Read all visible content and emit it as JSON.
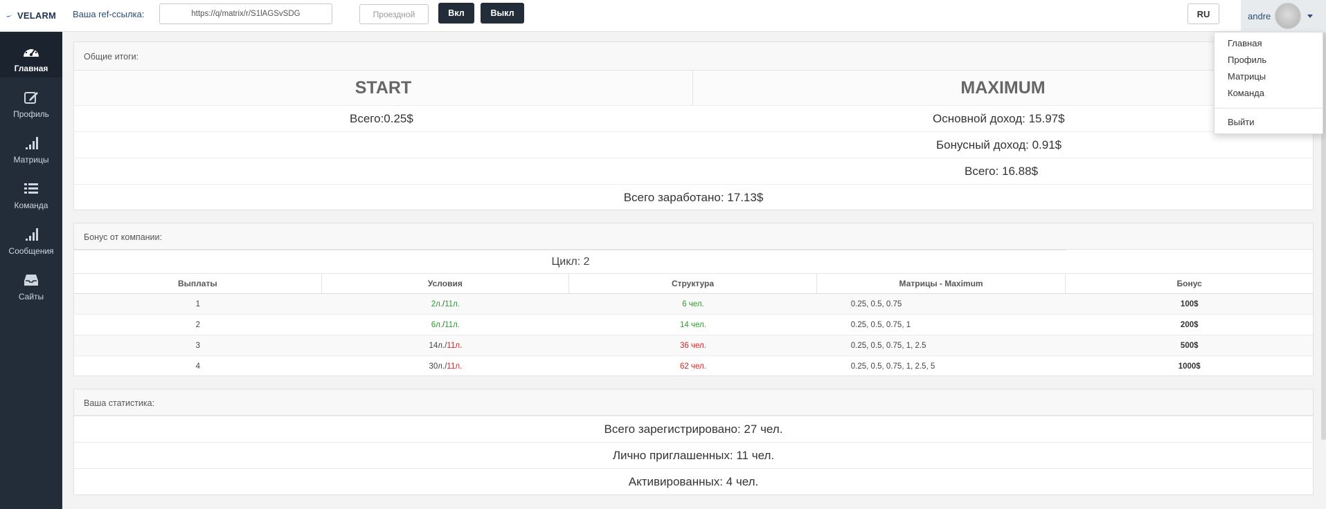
{
  "brand": {
    "name": "VELARM"
  },
  "topbar": {
    "ref_label": "Ваша ref-ссылка:",
    "ref_value": "https://q/matrix/r/S1lAGSvSDG",
    "prohod_label": "Проездной",
    "on_label": "Вкл",
    "off_label": "Выкл",
    "lang_label": "RU",
    "user_name": "andre"
  },
  "dropdown": {
    "items": [
      "Главная",
      "Профиль",
      "Матрицы",
      "Команда"
    ],
    "logout": "Выйти"
  },
  "sidebar": {
    "items": [
      {
        "label": "Главная",
        "icon": "dashboard-icon",
        "active": true
      },
      {
        "label": "Профиль",
        "icon": "edit-icon"
      },
      {
        "label": "Матрицы",
        "icon": "signal-bars-icon"
      },
      {
        "label": "Команда",
        "icon": "list-icon"
      },
      {
        "label": "Сообщения",
        "icon": "signal-bars-icon"
      },
      {
        "label": "Сайты",
        "icon": "inbox-icon"
      }
    ]
  },
  "totals": {
    "heading": "Общие итоги:",
    "start_title": "START",
    "max_title": "MAXIMUM",
    "start_total": "Всего:0.25$",
    "max_main": "Основной доход: 15.97$",
    "max_bonus": "Бонусный доход: 0.91$",
    "max_total": "Всего: 16.88$",
    "grand_total": "Всего заработано: 17.13$"
  },
  "bonus": {
    "heading": "Бонус от компании:",
    "cycle": "Цикл: 2",
    "columns": [
      "Выплаты",
      "Условия",
      "Структура",
      "Матрицы - Maximum",
      "Бонус"
    ],
    "rows": [
      {
        "n": "1",
        "cond_a": "2л.",
        "cond_b": "11л.",
        "cond_a_ok": true,
        "cond_b_ok": true,
        "struct": "6 чел.",
        "struct_ok": true,
        "matrices": "0.25, 0.5, 0.75",
        "bonus": "100$"
      },
      {
        "n": "2",
        "cond_a": "6л.",
        "cond_b": "11л.",
        "cond_a_ok": true,
        "cond_b_ok": true,
        "struct": "14 чел.",
        "struct_ok": true,
        "matrices": "0.25, 0.5, 0.75, 1",
        "bonus": "200$"
      },
      {
        "n": "3",
        "cond_a": "14л.",
        "cond_b": "11л.",
        "cond_a_ok": false,
        "cond_b_ok": false,
        "struct": "36 чел.",
        "struct_ok": false,
        "matrices": "0.25, 0.5, 0.75, 1, 2.5",
        "bonus": "500$"
      },
      {
        "n": "4",
        "cond_a": "30л.",
        "cond_b": "11л.",
        "cond_a_ok": false,
        "cond_b_ok": false,
        "struct": "62 чел.",
        "struct_ok": false,
        "matrices": "0.25, 0.5, 0.75, 1, 2.5, 5",
        "bonus": "1000$"
      }
    ]
  },
  "stats": {
    "heading": "Ваша статистика:",
    "registered": "Всего зарегистрировано: 27 чел.",
    "invited": "Лично приглашенных: 11 чел.",
    "activated": "Активированных: 4 чел."
  },
  "colors": {
    "sidebar": "#222d39",
    "ok": "#2a9d2a",
    "fail": "#e02020",
    "link": "#2a4d75"
  }
}
